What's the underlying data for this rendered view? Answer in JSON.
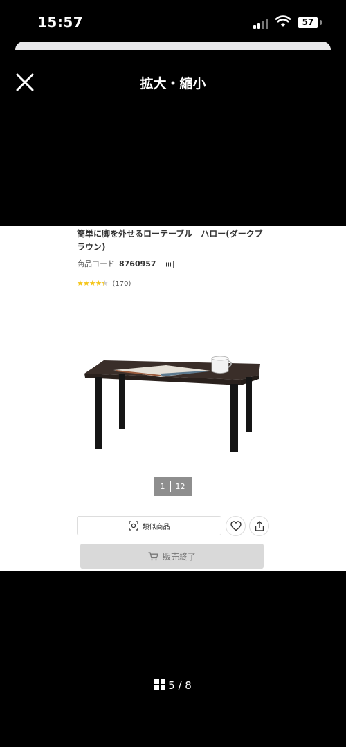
{
  "status_bar": {
    "time": "15:57",
    "battery": "57"
  },
  "header": {
    "title": "拡大・縮小"
  },
  "product": {
    "title": "簡単に脚を外せるローテーブル　ハロー(ダークブラウン)",
    "code_label": "商品コード",
    "code_value": "8760957",
    "rating": 4.5,
    "review_count": "(170)"
  },
  "image_pager": {
    "current": "1",
    "total": "12"
  },
  "actions": {
    "similar_label": "類似商品",
    "sold_out_label": "販売終了"
  },
  "gallery": {
    "counter": "5 / 8"
  },
  "colors": {
    "background": "#000000",
    "content_bg": "#ffffff",
    "star": "#f5c518",
    "pager_bg": "#8e8e8e",
    "disabled_btn": "#d9d9d9"
  },
  "icons": [
    "close-icon",
    "barcode-icon",
    "star-icon",
    "similar-search-icon",
    "heart-icon",
    "share-icon",
    "cart-icon",
    "grid-icon",
    "wifi-icon",
    "signal-icon",
    "battery-icon"
  ]
}
